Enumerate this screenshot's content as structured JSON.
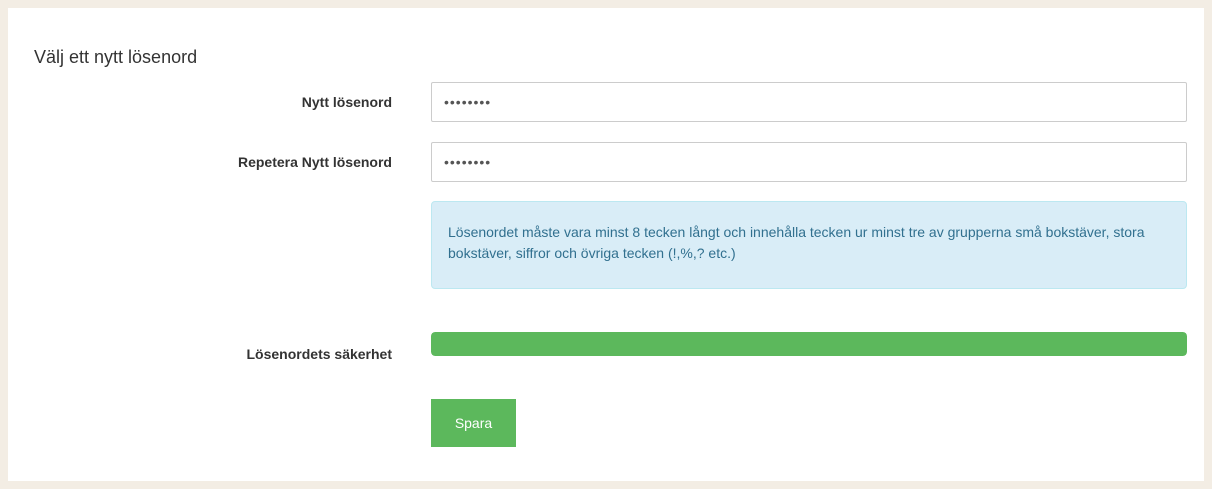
{
  "page": {
    "title": "Välj ett nytt lösenord"
  },
  "form": {
    "new_password": {
      "label": "Nytt lösenord",
      "value": "••••••••"
    },
    "repeat_password": {
      "label": "Repetera Nytt lösenord",
      "value": "••••••••"
    },
    "info_text": "Lösenordet måste vara minst 8 tecken långt och innehålla tecken ur minst tre av grupperna små bokstäver, stora bokstäver, siffror och övriga tecken (!,%,? etc.)",
    "strength": {
      "label": "Lösenordets säkerhet",
      "percent": 100,
      "color": "#5cb85c"
    },
    "save_label": "Spara"
  },
  "colors": {
    "page_background": "#f3ede4",
    "panel_background": "#ffffff",
    "info_background": "#d9edf7",
    "info_text": "#31708f",
    "success": "#5cb85c"
  }
}
